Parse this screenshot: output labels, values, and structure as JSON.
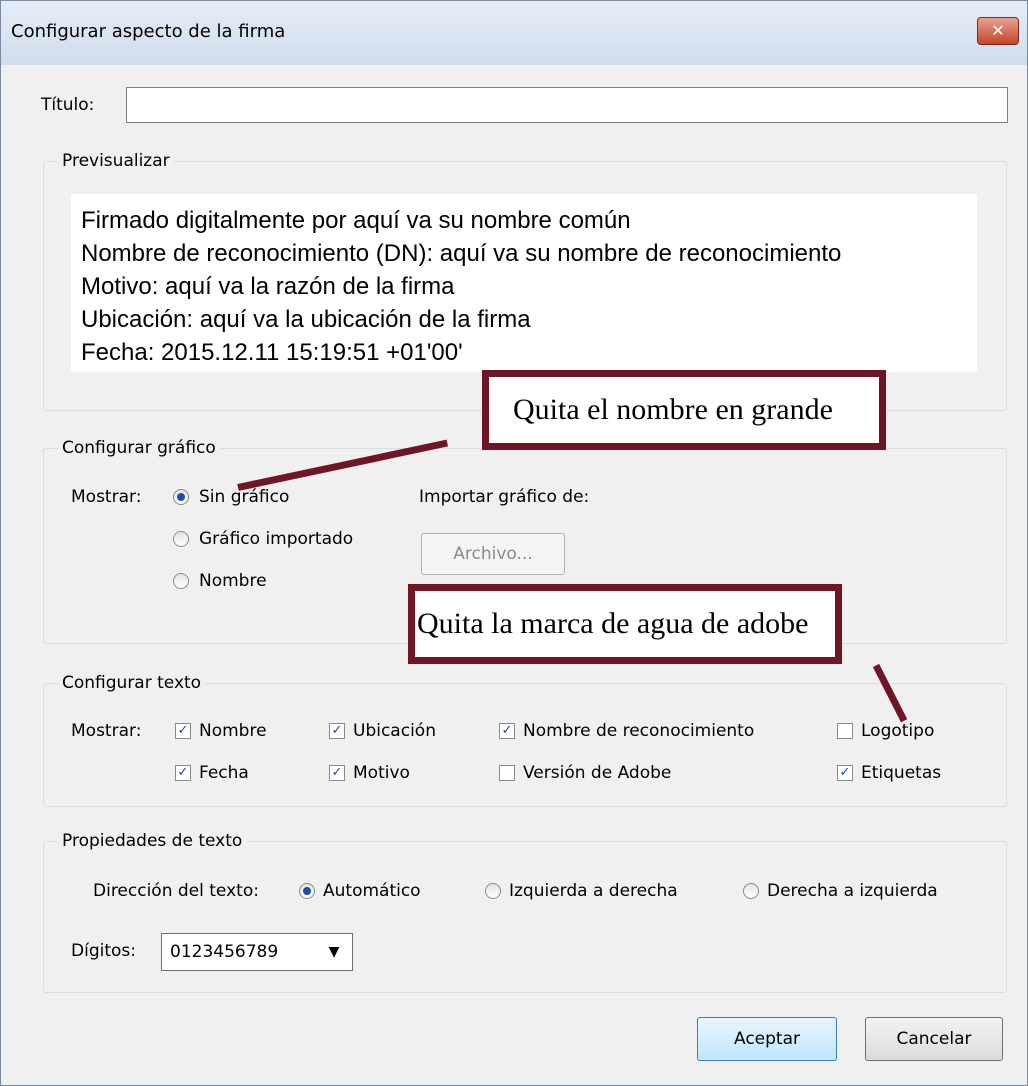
{
  "window": {
    "title": "Configurar aspecto de la firma",
    "close_glyph": "✕"
  },
  "title_field": {
    "label": "Título:",
    "value": ""
  },
  "preview": {
    "legend": "Previsualizar",
    "lines": [
      "Firmado digitalmente por aquí va su nombre común",
      "Nombre de reconocimiento (DN): aquí va su nombre de reconocimiento",
      "Motivo: aquí va la razón de la firma",
      "Ubicación: aquí va la ubicación de la firma",
      "Fecha: 2015.12.11 15:19:51 +01'00'"
    ]
  },
  "graphic": {
    "legend": "Configurar gráfico",
    "show_label": "Mostrar:",
    "options": [
      "Sin gráfico",
      "Gráfico importado",
      "Nombre"
    ],
    "selected": "Sin gráfico",
    "import_label": "Importar gráfico de:",
    "file_button": "Archivo..."
  },
  "text_config": {
    "legend": "Configurar texto",
    "show_label": "Mostrar:",
    "items": [
      {
        "label": "Nombre",
        "checked": true
      },
      {
        "label": "Ubicación",
        "checked": true
      },
      {
        "label": "Nombre de reconocimiento",
        "checked": true
      },
      {
        "label": "Logotipo",
        "checked": false
      },
      {
        "label": "Fecha",
        "checked": true
      },
      {
        "label": "Motivo",
        "checked": true
      },
      {
        "label": "Versión de Adobe",
        "checked": false
      },
      {
        "label": "Etiquetas",
        "checked": true
      }
    ],
    "check_glyph": "✓"
  },
  "text_properties": {
    "legend": "Propiedades de texto",
    "direction_label": "Dirección del texto:",
    "direction_options": [
      "Automático",
      "Izquierda a derecha",
      "Derecha a izquierda"
    ],
    "direction_selected": "Automático",
    "digits_label": "Dígitos:",
    "digits_value": "0123456789",
    "dropdown_glyph": "▼"
  },
  "buttons": {
    "ok": "Aceptar",
    "cancel": "Cancelar"
  },
  "annotations": {
    "callout_1": "Quita el nombre en grande",
    "callout_2": "Quita la marca de agua de adobe",
    "color": "#6f1528"
  }
}
